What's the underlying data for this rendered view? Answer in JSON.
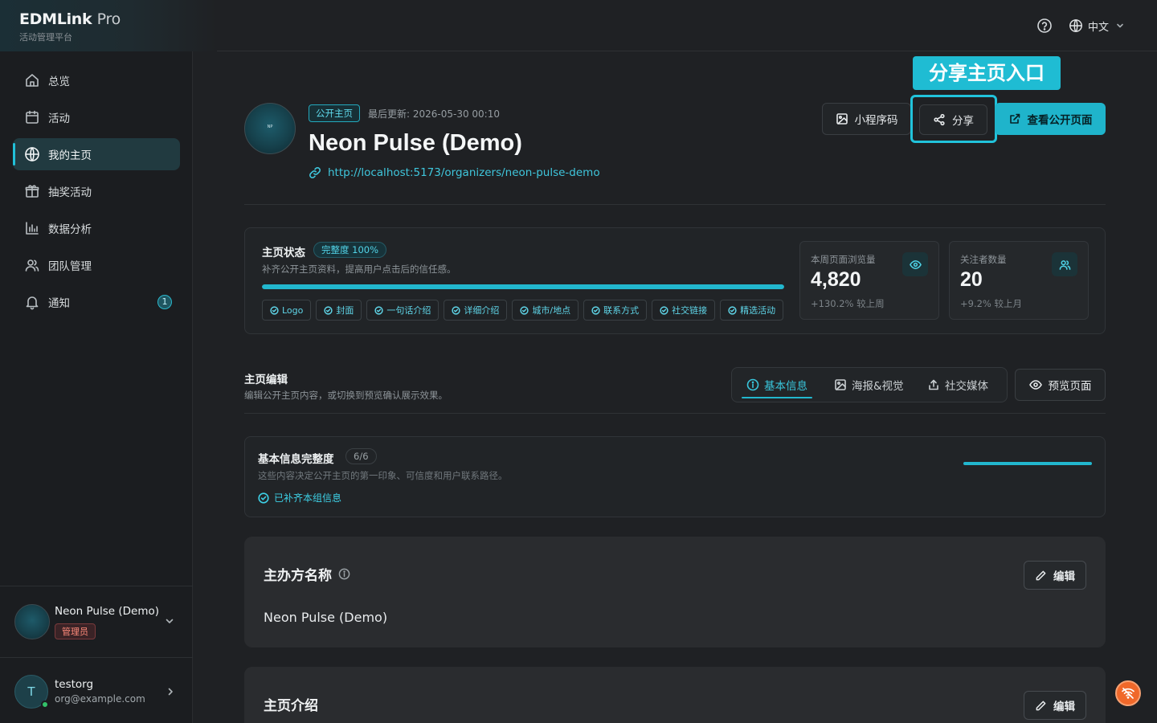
{
  "brand": {
    "name": "EDMLink",
    "suffix": "Pro",
    "subtitle": "活动管理平台"
  },
  "header": {
    "language": "中文"
  },
  "sidebar": {
    "items": [
      {
        "label": "总览",
        "icon": "home-icon"
      },
      {
        "label": "活动",
        "icon": "calendar-icon"
      },
      {
        "label": "我的主页",
        "icon": "globe-icon",
        "active": true
      },
      {
        "label": "抽奖活动",
        "icon": "gift-icon"
      },
      {
        "label": "数据分析",
        "icon": "bar-chart-icon"
      },
      {
        "label": "团队管理",
        "icon": "users-icon"
      },
      {
        "label": "通知",
        "icon": "bell-icon",
        "badge": "1"
      }
    ],
    "org": {
      "name": "Neon Pulse (Demo)",
      "role": "管理员"
    },
    "user": {
      "initial": "T",
      "name": "testorg",
      "email": "org@example.com"
    }
  },
  "profile": {
    "logo_text": "NP",
    "tag": "公开主页",
    "updated": "最后更新: 2026-05-30 00:10",
    "name": "Neon Pulse (Demo)",
    "url": "http://localhost:5173/organizers/neon-pulse-demo"
  },
  "actions": {
    "miniprogram": "小程序码",
    "share": "分享",
    "view_public": "查看公开页面",
    "share_callout": "分享主页入口"
  },
  "status": {
    "title": "主页状态",
    "completeness": "完整度 100%",
    "progress": 1.0,
    "desc": "补齐公开主页资料，提高用户点击后的信任感。",
    "chips": [
      "Logo",
      "封面",
      "一句话介绍",
      "详细介绍",
      "城市/地点",
      "联系方式",
      "社交链接",
      "精选活动"
    ],
    "views": {
      "label": "本周页面浏览量",
      "value": "4,820",
      "delta": "+130.2% 较上周"
    },
    "followers": {
      "label": "关注者数量",
      "value": "20",
      "delta": "+9.2% 较上月"
    }
  },
  "editor": {
    "title": "主页编辑",
    "desc": "编辑公开主页内容，或切换到预览确认展示效果。",
    "tabs": [
      "基本信息",
      "海报&视觉",
      "社交媒体"
    ],
    "preview": "预览页面"
  },
  "completeness": {
    "title": "基本信息完整度",
    "count": "6/6",
    "desc": "这些内容决定公开主页的第一印象、可信度和用户联系路径。",
    "done": "已补齐本组信息",
    "progress": 1.0
  },
  "fields": [
    {
      "title": "主办方名称",
      "value": "Neon Pulse (Demo)",
      "edit": "编辑"
    },
    {
      "title": "主页介绍",
      "value": "",
      "edit": "编辑"
    }
  ]
}
